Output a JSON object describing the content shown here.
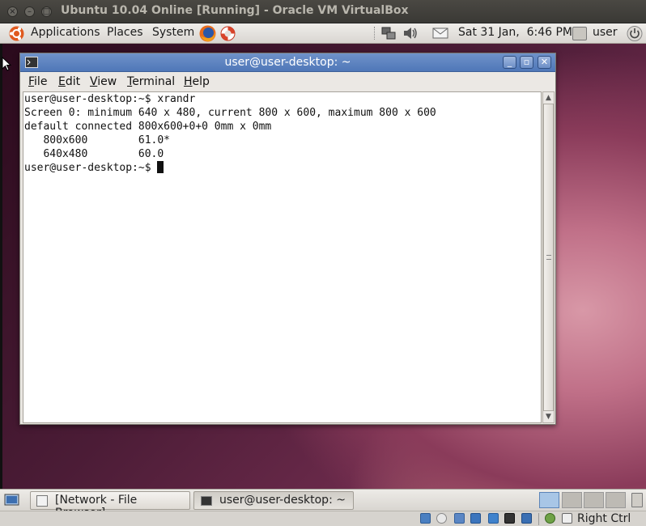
{
  "vbox": {
    "title": "Ubuntu 10.04 Online [Running] - Oracle VM VirtualBox",
    "host_key": "Right Ctrl"
  },
  "top_panel": {
    "menus": [
      "Applications",
      "Places",
      "System"
    ],
    "clock": "Sat 31 Jan,  6:46 PM",
    "user": "user"
  },
  "terminal": {
    "title": "user@user-desktop: ~",
    "menu": [
      {
        "key": "F",
        "rest": "ile"
      },
      {
        "key": "E",
        "rest": "dit"
      },
      {
        "key": "V",
        "rest": "iew"
      },
      {
        "key": "T",
        "rest": "erminal"
      },
      {
        "key": "H",
        "rest": "elp"
      }
    ],
    "lines": [
      "user@user-desktop:~$ xrandr",
      "Screen 0: minimum 640 x 480, current 800 x 600, maximum 800 x 600",
      "default connected 800x600+0+0 0mm x 0mm",
      "   800x600        61.0*",
      "   640x480        60.0"
    ],
    "prompt": "user@user-desktop:~$ "
  },
  "taskbar": {
    "tasks": [
      "[Network - File Browser]",
      "user@user-desktop: ~"
    ]
  },
  "colors": {
    "titlebar": "#4f77b8",
    "panel": "#e3e0dc"
  }
}
